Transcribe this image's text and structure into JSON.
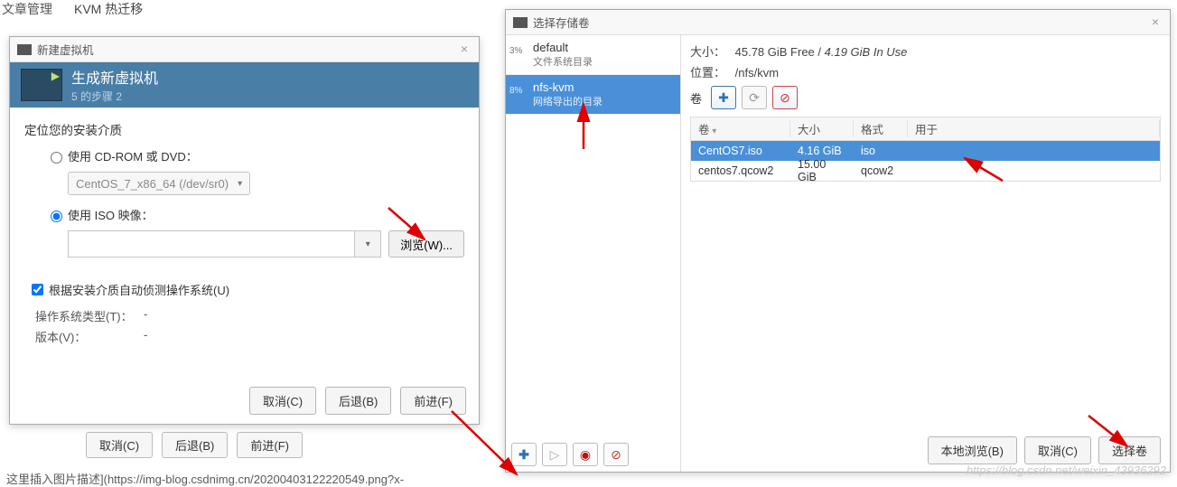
{
  "bg": {
    "tab": "文章管理",
    "kvm": "KVM 热迁移",
    "cancel": "取消(C)",
    "back": "后退(B)",
    "forward": "前进(F)",
    "text": "这里插入图片描述](https://img-blog.csdnimg.cn/20200403122220549.png?x-"
  },
  "newvm": {
    "title": "新建虚拟机",
    "h1": "生成新虚拟机",
    "h2": "5 的步骤 2",
    "locate": "定位您的安装介质",
    "opt_cd": "使用 CD-ROM 或 DVD：",
    "dropdown_cd": "CentOS_7_x86_64 (/dev/sr0)",
    "opt_iso": "使用 ISO 映像：",
    "browse": "浏览(W)...",
    "autodetect": "根据安装介质自动侦测操作系统(U)",
    "ostype_k": "操作系统类型(T)：",
    "ostype_v": "-",
    "ver_k": "版本(V)：",
    "ver_v": "-",
    "cancel": "取消(C)",
    "back": "后退(B)",
    "forward": "前进(F)"
  },
  "stor": {
    "title": "选择存储卷",
    "pools": [
      {
        "pct": "3%",
        "name": "default",
        "sub": "文件系统目录"
      },
      {
        "pct": "8%",
        "name": "nfs-kvm",
        "sub": "网络导出的目录"
      }
    ],
    "size_k": "大小：",
    "size_free": "45.78 GiB Free",
    "size_sep": " / ",
    "size_used": "4.19 GiB In Use",
    "loc_k": "位置：",
    "loc_v": "/nfs/kvm",
    "vol_k": "卷",
    "headers": {
      "c1": "卷",
      "c2": "大小",
      "c3": "格式",
      "c4": "用于"
    },
    "rows": [
      {
        "n": "CentOS7.iso",
        "s": "4.16 GiB",
        "f": "iso",
        "u": ""
      },
      {
        "n": "centos7.qcow2",
        "s": "15.00 GiB",
        "f": "qcow2",
        "u": ""
      }
    ],
    "local": "本地浏览(B)",
    "cancel": "取消(C)",
    "choose": "选择卷"
  },
  "watermark": "https://blog.csdn.net/weixin_43936292"
}
